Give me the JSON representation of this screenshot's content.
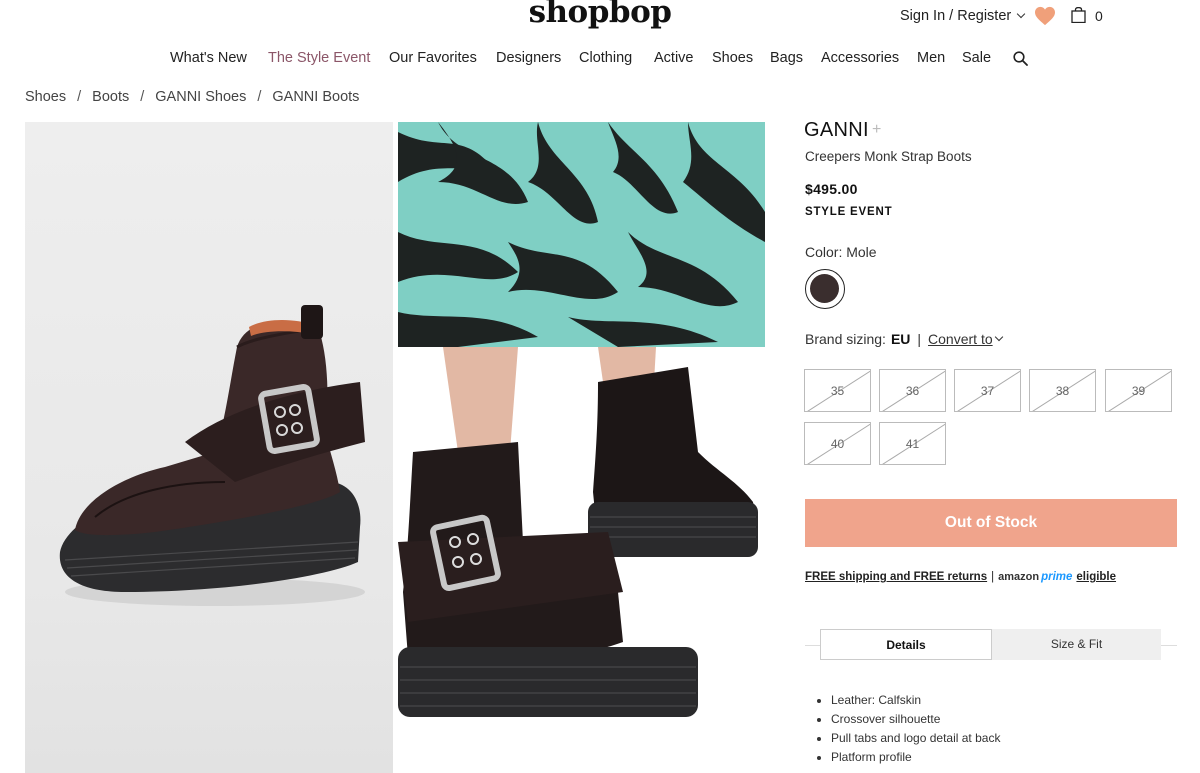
{
  "header": {
    "logo": "shopbop",
    "account_link": "Sign In / Register",
    "bag_count": "0"
  },
  "nav": {
    "items": [
      "What's New",
      "The Style Event",
      "Our Favorites",
      "Designers",
      "Clothing",
      "Active",
      "Shoes",
      "Bags",
      "Accessories",
      "Men",
      "Sale"
    ]
  },
  "breadcrumb": [
    "Shoes",
    "Boots",
    "GANNI Shoes",
    "GANNI Boots"
  ],
  "breadcrumb_sep": "/",
  "product": {
    "brand": "GANNI",
    "brand_suffix": "+",
    "name": "Creepers Monk Strap Boots",
    "price": "$495.00",
    "event": "STYLE EVENT",
    "color_label": "Color: Mole",
    "swatch_color": "#3a2e2e",
    "sizing_label": "Brand sizing:",
    "sizing_system": "EU",
    "sizing_sep": "|",
    "convert_label": "Convert to",
    "sizes": [
      "35",
      "36",
      "37",
      "38",
      "39",
      "40",
      "41"
    ],
    "button_label": "Out of Stock",
    "shipping": {
      "text": "FREE shipping and FREE returns",
      "sep": "|",
      "amazon": "amazon",
      "prime": "prime",
      "eligible": "eligible"
    },
    "tabs": [
      "Details",
      "Size & Fit"
    ],
    "details": [
      "Leather: Calfskin",
      "Crossover silhouette",
      "Pull tabs and logo detail at back",
      "Platform profile"
    ]
  },
  "colors": {
    "accent_nav": "#8b5668",
    "button_bg": "#f0a48c",
    "heart": "#f0a07a",
    "prime_blue": "#1a98ff",
    "skirt_teal": "#7fcfc4"
  }
}
